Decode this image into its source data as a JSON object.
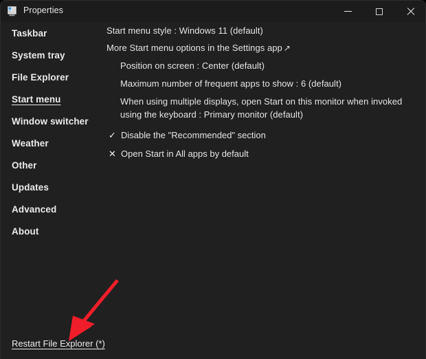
{
  "window": {
    "title": "Properties",
    "icon": "properties-monitor-icon",
    "bg_color": "#202020",
    "titlebar_color": "#1c1c1c"
  },
  "titlebar_buttons": {
    "minimize": "minimize-icon",
    "maximize": "maximize-icon",
    "close": "close-icon"
  },
  "sidebar": {
    "items": [
      {
        "label": "Taskbar",
        "active": false
      },
      {
        "label": "System tray",
        "active": false
      },
      {
        "label": "File Explorer",
        "active": false
      },
      {
        "label": "Start menu",
        "active": true
      },
      {
        "label": "Window switcher",
        "active": false
      },
      {
        "label": "Weather",
        "active": false
      },
      {
        "label": "Other",
        "active": false
      },
      {
        "label": "Updates",
        "active": false
      },
      {
        "label": "Advanced",
        "active": false
      },
      {
        "label": "About",
        "active": false
      }
    ]
  },
  "main": {
    "settings": [
      {
        "text": "Start menu style : Windows 11 (default)",
        "indent": false
      },
      {
        "text": "More Start menu options in the Settings app",
        "indent": false,
        "external_link": true,
        "external_glyph": "↗"
      },
      {
        "text": "Position on screen : Center (default)",
        "indent": true
      },
      {
        "text": "Maximum number of frequent apps to show : 6 (default)",
        "indent": true
      },
      {
        "text": "When using multiple displays, open Start on this monitor when invoked using the keyboard : Primary monitor (default)",
        "indent": true
      }
    ],
    "checkable": [
      {
        "mark": "✓",
        "mark_name": "check-icon",
        "label": "Disable the \"Recommended\" section",
        "checked": true
      },
      {
        "mark": "✕",
        "mark_name": "cross-icon",
        "label": "Open Start in All apps by default",
        "checked": false
      }
    ]
  },
  "footer": {
    "restart_label": "Restart File Explorer (*)"
  },
  "annotation": {
    "arrow_color": "#f01e2a",
    "name": "red-annotation-arrow"
  }
}
